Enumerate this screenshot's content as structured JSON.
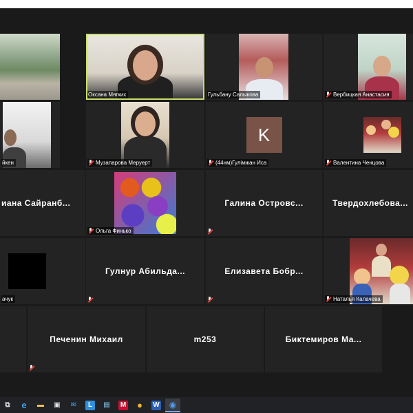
{
  "participants": [
    {
      "id": "p01",
      "name": "",
      "muted": false,
      "kind": "video"
    },
    {
      "id": "p02",
      "name": "Оксана Мягких",
      "muted": false,
      "kind": "video",
      "active": true
    },
    {
      "id": "p03",
      "name": "Гульбану Салыкова",
      "muted": false,
      "kind": "video"
    },
    {
      "id": "p04",
      "name": "Вербицкая Анастасия",
      "muted": true,
      "kind": "video"
    },
    {
      "id": "p05",
      "name": "йкен",
      "muted": false,
      "kind": "video"
    },
    {
      "id": "p06",
      "name": "Музапарова Меруерт",
      "muted": true,
      "kind": "video"
    },
    {
      "id": "p07",
      "name": "(44нм)Гулімжан Иса",
      "muted": true,
      "kind": "avatar",
      "avatar_letter": "K"
    },
    {
      "id": "p08",
      "name": "Валентина Ченцова",
      "muted": true,
      "kind": "video"
    },
    {
      "id": "p09",
      "name": "иана  Сайранб...",
      "muted": false,
      "kind": "name"
    },
    {
      "id": "p10",
      "name": "Ольга Финько",
      "muted": true,
      "kind": "video"
    },
    {
      "id": "p11",
      "name": "Галина  Островс...",
      "muted": true,
      "kind": "name"
    },
    {
      "id": "p12",
      "name": "Твердохлебова...",
      "muted": false,
      "kind": "name"
    },
    {
      "id": "p13",
      "name": "ачук",
      "muted": false,
      "kind": "black"
    },
    {
      "id": "p14",
      "name": "Гулнур  Абильда...",
      "muted": true,
      "kind": "name"
    },
    {
      "id": "p15",
      "name": "Елизавета  Бобр...",
      "muted": true,
      "kind": "name"
    },
    {
      "id": "p16",
      "name": "Наталья Калачева",
      "muted": true,
      "kind": "video"
    },
    {
      "id": "p17",
      "name": "Печенин Михаил",
      "muted": true,
      "kind": "name"
    },
    {
      "id": "p18",
      "name": "m253",
      "muted": false,
      "kind": "name"
    },
    {
      "id": "p19",
      "name": "Биктемиров  Ма...",
      "muted": false,
      "kind": "name"
    }
  ],
  "taskbar": {
    "items": [
      {
        "icon": "task-view-icon",
        "glyph": "⧉"
      },
      {
        "icon": "edge-browser-icon",
        "glyph": "e"
      },
      {
        "icon": "file-explorer-icon",
        "glyph": "▬"
      },
      {
        "icon": "store-icon",
        "glyph": "▣"
      },
      {
        "icon": "mail-icon",
        "glyph": "✉"
      },
      {
        "icon": "l-app-icon",
        "glyph": "L"
      },
      {
        "icon": "briefcase-icon",
        "glyph": "▤"
      },
      {
        "icon": "mcafee-icon",
        "glyph": "M"
      },
      {
        "icon": "chrome-icon",
        "glyph": "●"
      },
      {
        "icon": "word-icon",
        "glyph": "W"
      },
      {
        "icon": "zoom-icon",
        "glyph": "◉",
        "active": true
      }
    ]
  },
  "colors": {
    "active_speaker": "#c9e06a",
    "background": "#1a1a1a",
    "tile": "#232323",
    "muted": "#e2413a"
  }
}
